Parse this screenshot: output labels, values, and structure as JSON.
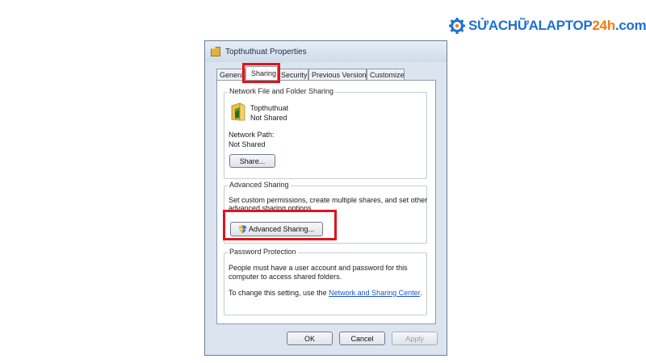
{
  "brand": {
    "text_main": "SỬACHỮALAPTOP",
    "text_num": "24h",
    "text_dom": ".com",
    "icon": "gear-icon"
  },
  "dialog": {
    "title": "Topthuthuat Properties",
    "title_icon": "folder-icon"
  },
  "tabs": [
    {
      "label": "General",
      "active": false
    },
    {
      "label": "Sharing",
      "active": true
    },
    {
      "label": "Security",
      "active": false
    },
    {
      "label": "Previous Versions",
      "active": false
    },
    {
      "label": "Customize",
      "active": false
    }
  ],
  "network_sharing": {
    "group_title": "Network File and Folder Sharing",
    "folder_name": "Topthuthuat",
    "folder_status": "Not Shared",
    "path_label": "Network Path:",
    "path_value": "Not Shared",
    "share_button": "Share..."
  },
  "advanced_sharing": {
    "group_title": "Advanced Sharing",
    "description_line1": "Set custom permissions, create multiple shares, and set other",
    "description_line2": "advanced sharing options.",
    "button_label": "Advanced Sharing...",
    "button_icon": "shield-icon"
  },
  "password_protection": {
    "group_title": "Password Protection",
    "line1": "People must have a user account and password for this",
    "line2": "computer to access shared folders.",
    "change_prefix": "To change this setting, use the ",
    "change_link": "Network and Sharing Center",
    "change_suffix": "."
  },
  "footer": {
    "ok": "OK",
    "cancel": "Cancel",
    "apply": "Apply"
  },
  "colors": {
    "highlight": "#e0141b",
    "link": "#1a56c8",
    "brand_blue": "#1f6fd1",
    "brand_orange": "#f07b16"
  }
}
